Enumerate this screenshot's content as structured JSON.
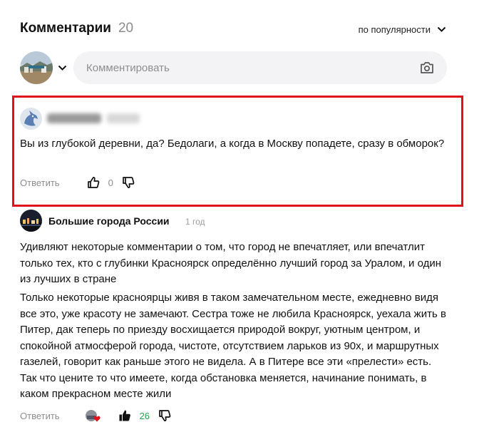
{
  "header": {
    "title": "Комментарии",
    "count": "20",
    "sort_label": "по популярности"
  },
  "composer": {
    "placeholder": "Комментировать"
  },
  "comments": [
    {
      "author_blurred": true,
      "text": "Вы из глубокой деревни, да? Бедолаги, а когда в Москву попадете, сразу в обморок?",
      "reply_label": "Ответить",
      "likes": "0",
      "highlighted_color": "#e0121a"
    },
    {
      "author": "Большие города России",
      "time": "1 год",
      "paragraphs": [
        "Удивляют некоторые комментарии о том, что город не впечатляет, или впечатлит только тех, кто с глубинки  Красноярск определённо лучший город за Уралом, и один из лучших в стране",
        "Только некоторые красноярцы живя в таком замечательном месте, ежедневно видя все это, уже красоту не замечают. Сестра тоже не любила Красноярск, уехала жить в Питер, дак теперь по приезду восхищается природой вокруг, уютным центром, и спокойной атмосферой города, чистоте, отсутствием ларьков из 90х, и маршрутных газелей, говорит как раньше этого не видела. А в Питере все эти «прелести» есть. Так что цените то что имеете, когда обстановка меняется, начинание понимать, в каком прекрасном месте жили"
      ],
      "reply_label": "Ответить",
      "likes": "26",
      "likes_color": "#22a54a"
    }
  ]
}
